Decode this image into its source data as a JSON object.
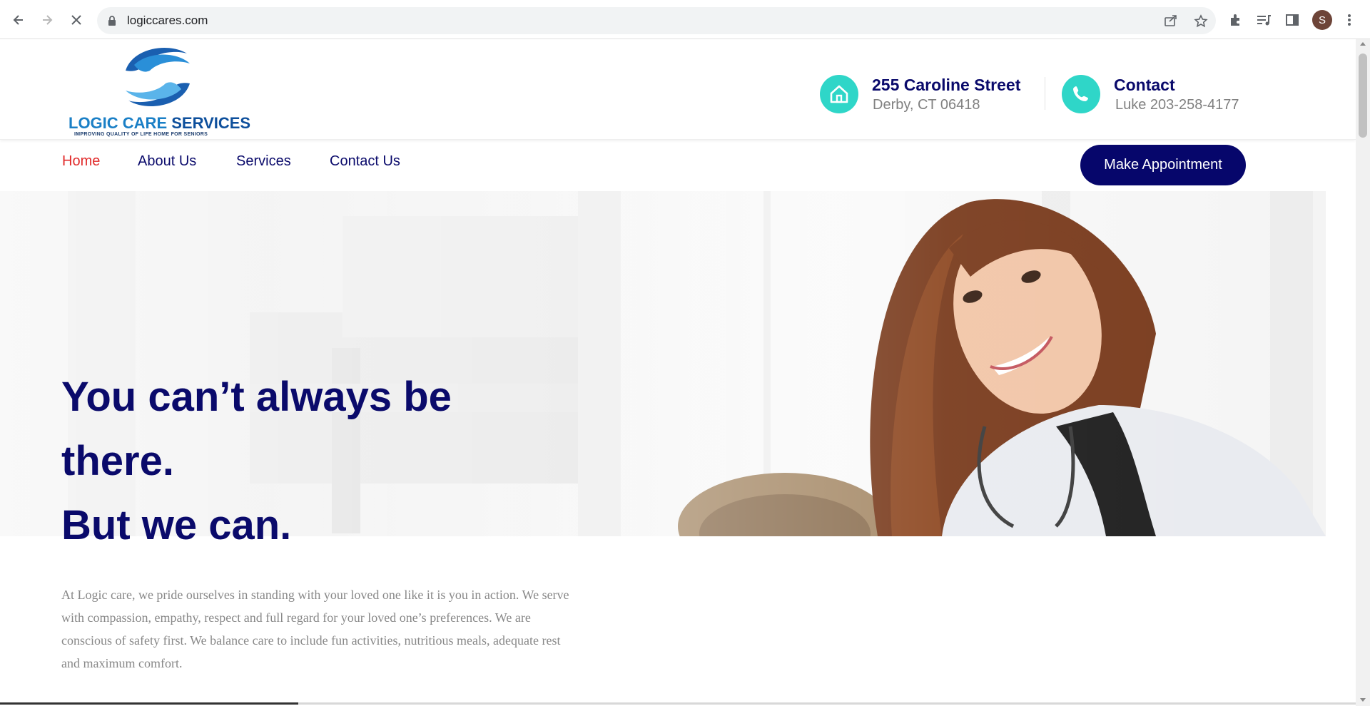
{
  "browser": {
    "url": "logiccares.com",
    "profile_initial": "S"
  },
  "site": {
    "logo": {
      "name_part1": "LOGIC CARE ",
      "name_part2": "SERVICES",
      "tagline": "IMPROVING QUALITY OF LIFE HOME FOR SENIORS"
    },
    "address": {
      "title": "255 Caroline Street",
      "sub": "Derby, CT 06418"
    },
    "contact": {
      "title": "Contact",
      "sub": "Luke 203-258-4177"
    },
    "nav": {
      "home": "Home",
      "about": "About Us",
      "services": "Services",
      "contact": "Contact Us"
    },
    "cta": "Make Appointment",
    "hero": {
      "line1": "You can’t always be",
      "line2": "there.",
      "line3": "But we can.",
      "paragraph": "At Logic care, we pride ourselves in standing with your loved one like it is you in action. We serve with compassion, empathy, respect and full regard for your loved one’s preferences. We are conscious of safety first. We balance care to include fun activities, nutritious meals, adequate rest and maximum comfort."
    }
  },
  "colors": {
    "brand_navy": "#0a0a6b",
    "accent_teal": "#2fd6c8",
    "active_red": "#e12a2a",
    "logo_blue": "#1a7fc6"
  }
}
